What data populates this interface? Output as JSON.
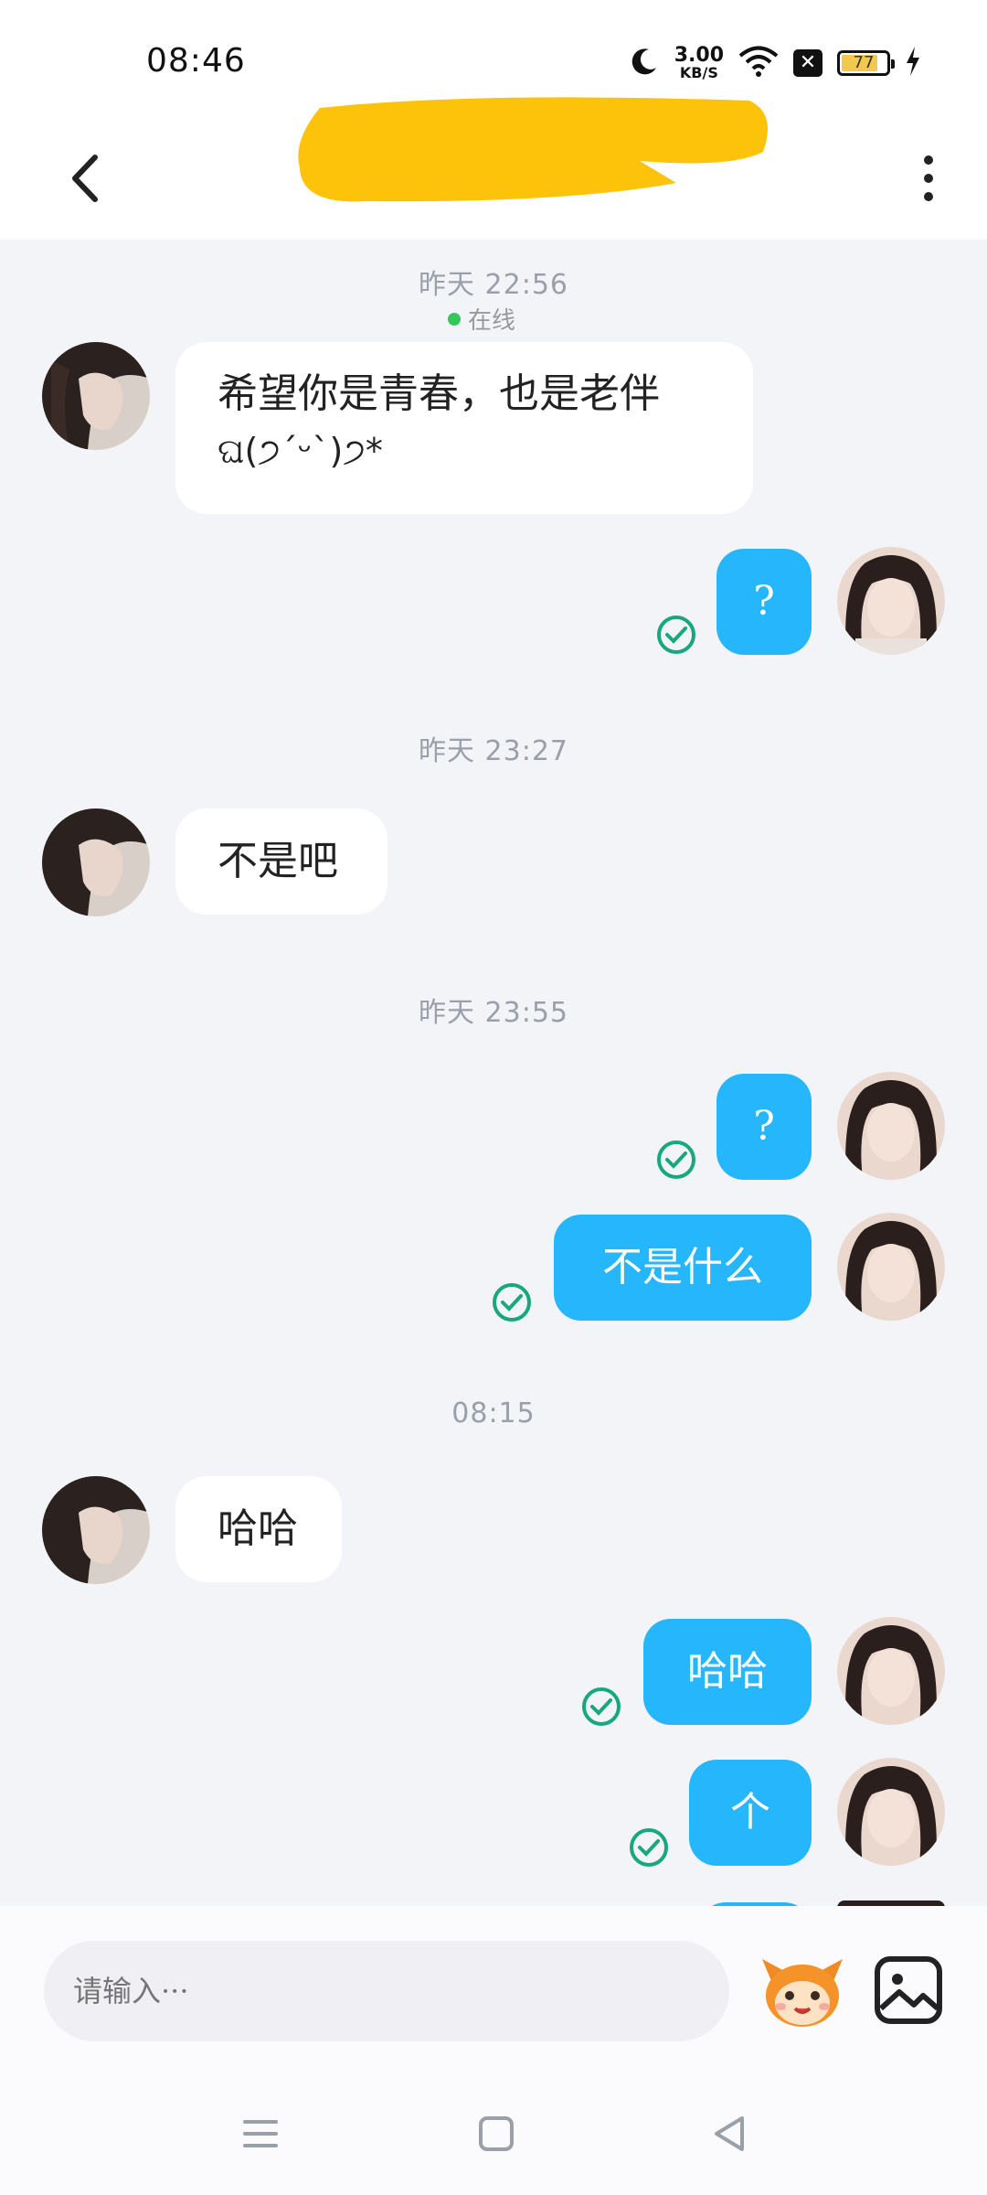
{
  "status_bar": {
    "time": "08:46",
    "net_speed_value": "3.00",
    "net_speed_unit": "KB/S",
    "battery_level": "77",
    "icons": [
      "moon-icon",
      "wifi-icon",
      "close-box-icon",
      "battery-icon",
      "charging-bolt-icon"
    ]
  },
  "header": {
    "contact_name_redacted": true,
    "online_status": "在线",
    "icons": [
      "back-arrow-icon",
      "more-vert-icon"
    ]
  },
  "messages": [
    {
      "type": "timestamp",
      "text": "昨天 22:56"
    },
    {
      "type": "incoming",
      "text_line1": "希望你是青春，也是老伴",
      "text_line2": "ଘ(੭ˊᵕˋ)੭*"
    },
    {
      "type": "outgoing",
      "text": "?",
      "status": "read"
    },
    {
      "type": "timestamp",
      "text": "昨天 23:27"
    },
    {
      "type": "incoming",
      "text": "不是吧"
    },
    {
      "type": "timestamp",
      "text": "昨天 23:55"
    },
    {
      "type": "outgoing",
      "text": "?",
      "status": "read"
    },
    {
      "type": "outgoing",
      "text": "不是什么",
      "status": "read"
    },
    {
      "type": "timestamp",
      "text": "08:15"
    },
    {
      "type": "incoming",
      "text": "哈哈"
    },
    {
      "type": "outgoing",
      "text": "哈哈",
      "status": "read"
    },
    {
      "type": "outgoing",
      "text": "个",
      "status": "read"
    }
  ],
  "input": {
    "placeholder": "请输入···"
  },
  "colors": {
    "outgoing_bubble": "#25b6fb",
    "incoming_bubble": "#ffffff",
    "chat_background": "#f3f4f8",
    "read_check": "#18a77e",
    "online_dot": "#36c75c"
  }
}
